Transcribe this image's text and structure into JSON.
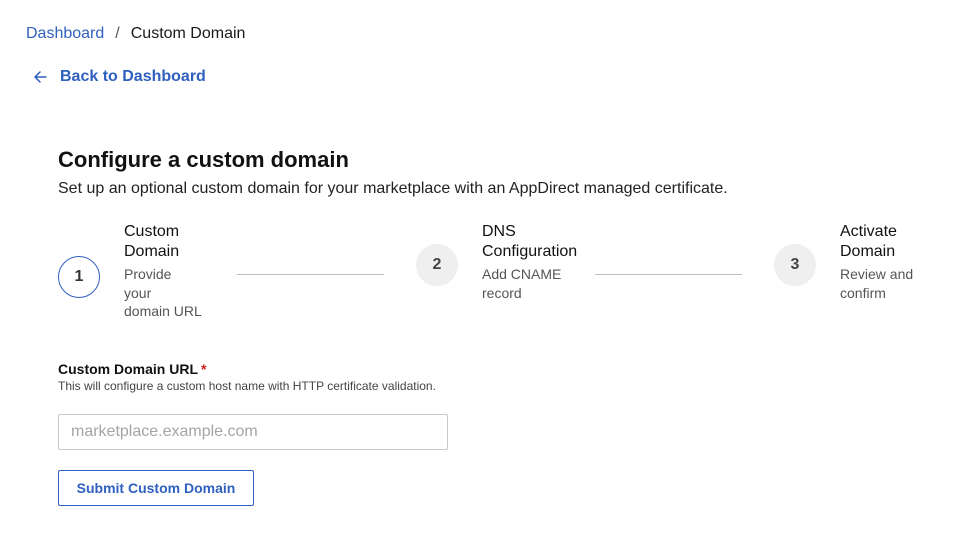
{
  "breadcrumb": {
    "parent": "Dashboard",
    "separator": "/",
    "current": "Custom Domain"
  },
  "back_link": {
    "label": "Back to Dashboard",
    "icon": "arrow-left-icon"
  },
  "header": {
    "title": "Configure a custom domain",
    "subtitle": "Set up an optional custom domain for your marketplace with an AppDirect managed certificate."
  },
  "stepper": {
    "steps": [
      {
        "number": "1",
        "title_line1": "Custom",
        "title_line2": "Domain",
        "desc_line1": "Provide",
        "desc_line2": "your",
        "desc_line3": "domain URL",
        "active": true
      },
      {
        "number": "2",
        "title_line1": "DNS",
        "title_line2": "Configuration",
        "desc_line1": "Add CNAME",
        "desc_line2": "record",
        "desc_line3": "",
        "active": false
      },
      {
        "number": "3",
        "title_line1": "Activate",
        "title_line2": "Domain",
        "desc_line1": "Review and",
        "desc_line2": "confirm",
        "desc_line3": "",
        "active": false
      }
    ]
  },
  "form": {
    "label": "Custom Domain URL",
    "required_marker": "*",
    "help": "This will configure a custom host name with HTTP certificate validation.",
    "value": "",
    "placeholder": "marketplace.example.com",
    "submit_label": "Submit Custom Domain"
  },
  "colors": {
    "link": "#2f5fbf",
    "required": "#d02020",
    "step_inactive_bg": "#efefef"
  }
}
